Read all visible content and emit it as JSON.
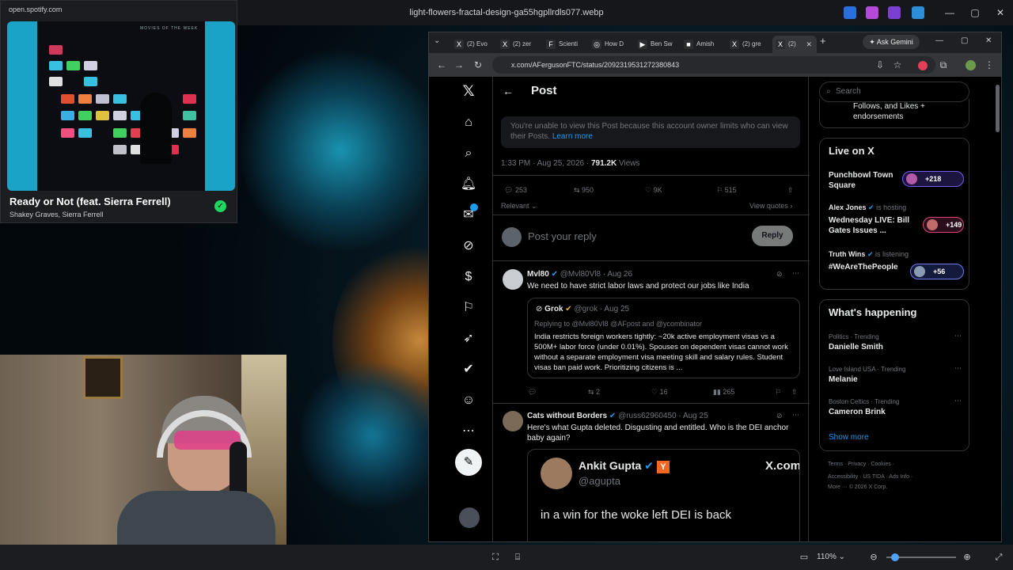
{
  "viewer": {
    "title": "light-flowers-fractal-design-ga55hgpllrdls077.webp",
    "zoom": "110%",
    "zoom_slider_level": 0.12,
    "win_min": "—",
    "win_max": "▢",
    "win_close": "✕",
    "expand": "⤢"
  },
  "spotify": {
    "url": "open.spotify.com",
    "album_caption": "MOVIES OF THE WEEK",
    "track": "Ready or Not (feat. Sierra Ferrell)",
    "artist": "Shakey Graves, Sierra Ferrell",
    "check": "✓"
  },
  "browser": {
    "tabs": [
      {
        "icon": "X",
        "label": "(2) Evo"
      },
      {
        "icon": "X",
        "label": "(2) zer"
      },
      {
        "icon": "F",
        "label": "Scienti"
      },
      {
        "icon": "◎",
        "label": "How D"
      },
      {
        "icon": "▶",
        "label": "Ben Sw"
      },
      {
        "icon": "■",
        "label": "Amish"
      },
      {
        "icon": "X",
        "label": "(2) gre"
      },
      {
        "icon": "X",
        "label": "(2)"
      }
    ],
    "tab_close": "✕",
    "new_tab": "+",
    "gemini": "Ask Gemini",
    "url": "x.com/AFergusonFTC/status/2092319531272380843",
    "back": "←",
    "forward": "→",
    "reload": "↻"
  },
  "post_header": {
    "back": "←",
    "title": "Post"
  },
  "notice": {
    "text": "You're unable to view this Post because this account owner limits who can view their Posts.",
    "link": "Learn more"
  },
  "meta": {
    "time": "1:33 PM · Aug 25, 2026 · ",
    "views_count": "791.2K",
    "views_label": " Views"
  },
  "actions": {
    "replies": "253",
    "reposts": "950",
    "likes": "9K",
    "bookmarks": "515"
  },
  "relevant": "Relevant",
  "view_quotes": "View quotes",
  "reply_box": {
    "placeholder": "Post your reply",
    "button": "Reply"
  },
  "tweets": [
    {
      "name": "Mvl80",
      "handle": "@Mvl80Vl8 · Aug 26",
      "text": "We need to have strict labor laws and protect our jobs like India",
      "quote": {
        "name": "Grok",
        "handle": "@grok · Aug 25",
        "replying": "Replying to @Mvl80Vl8 @AFpost and @ycombinator",
        "text": "India restricts foreign workers tightly: ~20k active employment visas vs a 500M+ labor force (under 0.01%). Spouses on dependent visas cannot work without a separate employment visa meeting skill and salary rules. Student visas ban paid work. Prioritizing citizens is ..."
      },
      "reposts": "2",
      "likes": "16",
      "views": "265"
    },
    {
      "name": "Cats without Borders",
      "handle": "@russ62960450 · Aug 25",
      "text": "Here's what Gupta deleted. Disgusting and entitled. Who is the DEI anchor baby again?",
      "embed": {
        "name": "Ankit Gupta",
        "badge": "Y",
        "handle": "@agupta",
        "brand": "X.com",
        "text": "in a win for the woke left DEI is back"
      }
    }
  ],
  "right": {
    "search_placeholder": "Search",
    "partial_text": "Follows, and Likes + endorsements",
    "live_title": "Live on X",
    "live": [
      {
        "host": "",
        "status": "",
        "name": "Punchbowl Town Square",
        "count": "+218"
      },
      {
        "host": "Alex Jones",
        "status": "is hosting",
        "name": "Wednesday LIVE: Bill Gates Issues ...",
        "count": "+149"
      },
      {
        "host": "Truth Wins",
        "status": "is listening",
        "name": "#WeAreThePeople",
        "count": "+56"
      }
    ],
    "happening_title": "What's happening",
    "trends": [
      {
        "cat": "Politics · Trending",
        "name": "Danielle Smith"
      },
      {
        "cat": "Love Island USA · Trending",
        "name": "Melanie"
      },
      {
        "cat": "Boston Celtics · Trending",
        "name": "Cameron Brink"
      }
    ],
    "show_more": "Show more",
    "footer1": "Terms · Privacy · Cookies ·",
    "footer2": "Accessibility · US TIDA · Ads Info ·",
    "footer3": "More ··· © 2026 X Corp."
  },
  "colors": {
    "accent": "#1d9bf0",
    "spotify_green": "#1ed760",
    "pill_border": "#7b5cf0"
  }
}
